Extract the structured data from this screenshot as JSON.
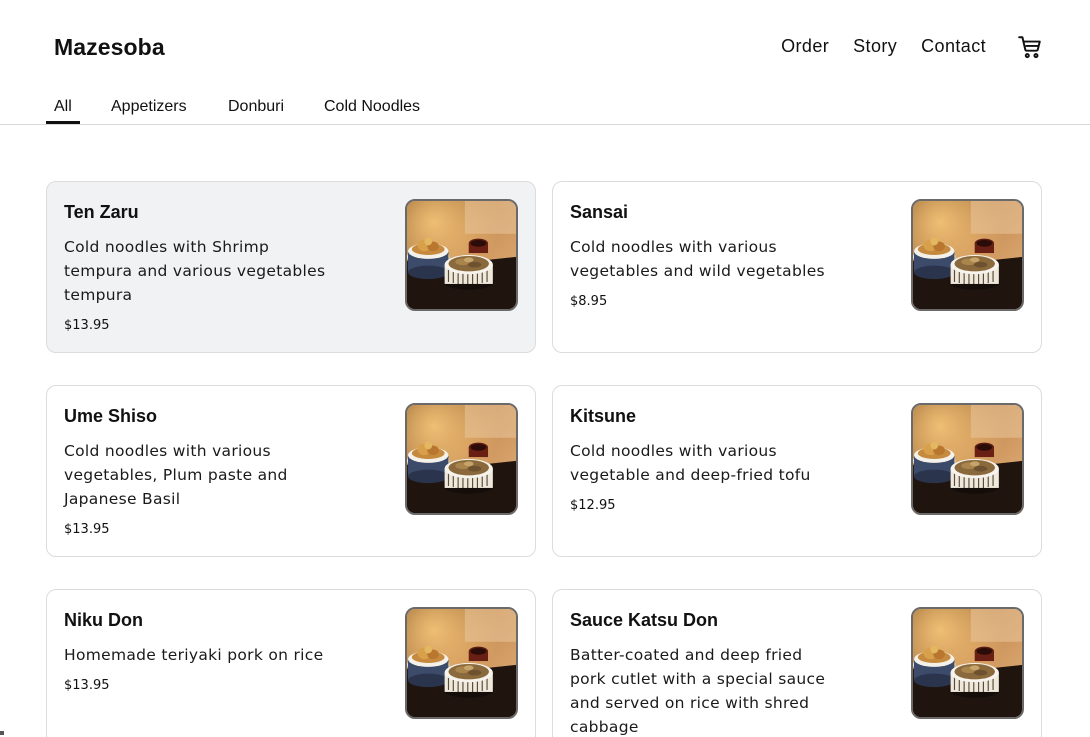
{
  "header": {
    "brand": "Mazesoba",
    "nav": [
      "Order",
      "Story",
      "Contact"
    ],
    "cart_icon": "cart-icon"
  },
  "tabs": {
    "items": [
      "All",
      "Appetizers",
      "Donburi",
      "Cold Noodles"
    ],
    "active": "All"
  },
  "menu": [
    {
      "title": "Ten Zaru",
      "desc": "Cold noodles with Shrimp tempura and various vegetables tempura",
      "price": "$13.95"
    },
    {
      "title": "Sansai",
      "desc": "Cold noodles with various vegetables and wild vegetables",
      "price": "$8.95"
    },
    {
      "title": "Ume Shiso",
      "desc": "Cold noodles with various vegetables, Plum paste and Japanese Basil",
      "price": "$13.95"
    },
    {
      "title": "Kitsune",
      "desc": "Cold noodles with various vegetable and deep-fried tofu",
      "price": "$12.95"
    },
    {
      "title": "Niku Don",
      "desc": "Homemade teriyaki pork on rice",
      "price": "$13.95"
    },
    {
      "title": "Sauce Katsu Don",
      "desc": "Batter-coated and deep fried pork cutlet with a special sauce and served on rice with shred cabbage",
      "price": ""
    }
  ],
  "colors": {
    "accent": "#111111",
    "card_border": "#dcdcdc",
    "card_hover_bg": "#f1f2f4"
  }
}
